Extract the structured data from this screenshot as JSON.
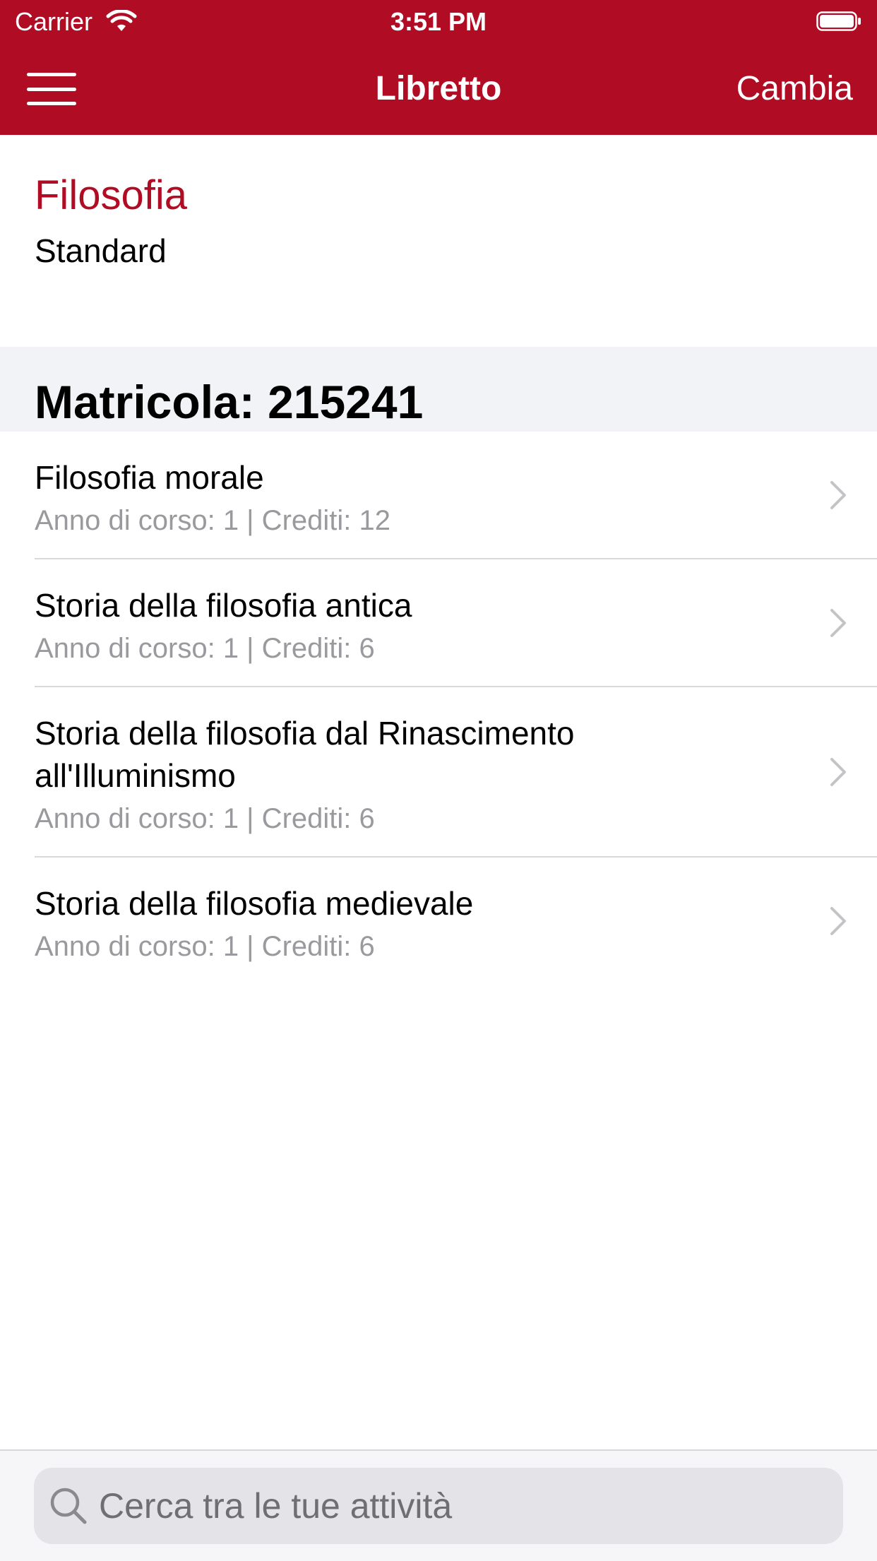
{
  "status_bar": {
    "carrier": "Carrier",
    "time": "3:51 PM"
  },
  "nav": {
    "title": "Libretto",
    "action": "Cambia"
  },
  "header": {
    "course": "Filosofia",
    "plan": "Standard"
  },
  "section": {
    "title": "Matricola: 215241"
  },
  "list": {
    "items": [
      {
        "title": "Filosofia morale",
        "subtitle": "Anno di corso: 1 | Crediti: 12"
      },
      {
        "title": "Storia della filosofia antica",
        "subtitle": "Anno di corso: 1 | Crediti: 6"
      },
      {
        "title": "Storia della filosofia dal Rinascimento all'Illuminismo",
        "subtitle": "Anno di corso: 1 | Crediti: 6"
      },
      {
        "title": "Storia della filosofia medievale",
        "subtitle": "Anno di corso: 1 | Crediti: 6"
      }
    ]
  },
  "search": {
    "placeholder": "Cerca tra le tue attività"
  },
  "colors": {
    "brand": "#B00D25",
    "secondary_text": "#9A9A9E",
    "section_bg": "#F2F3F6"
  },
  "icons": {
    "menu": "hamburger-menu-icon",
    "chevron": "chevron-right-icon",
    "search": "search-icon",
    "wifi": "wifi-icon",
    "battery": "battery-icon"
  }
}
